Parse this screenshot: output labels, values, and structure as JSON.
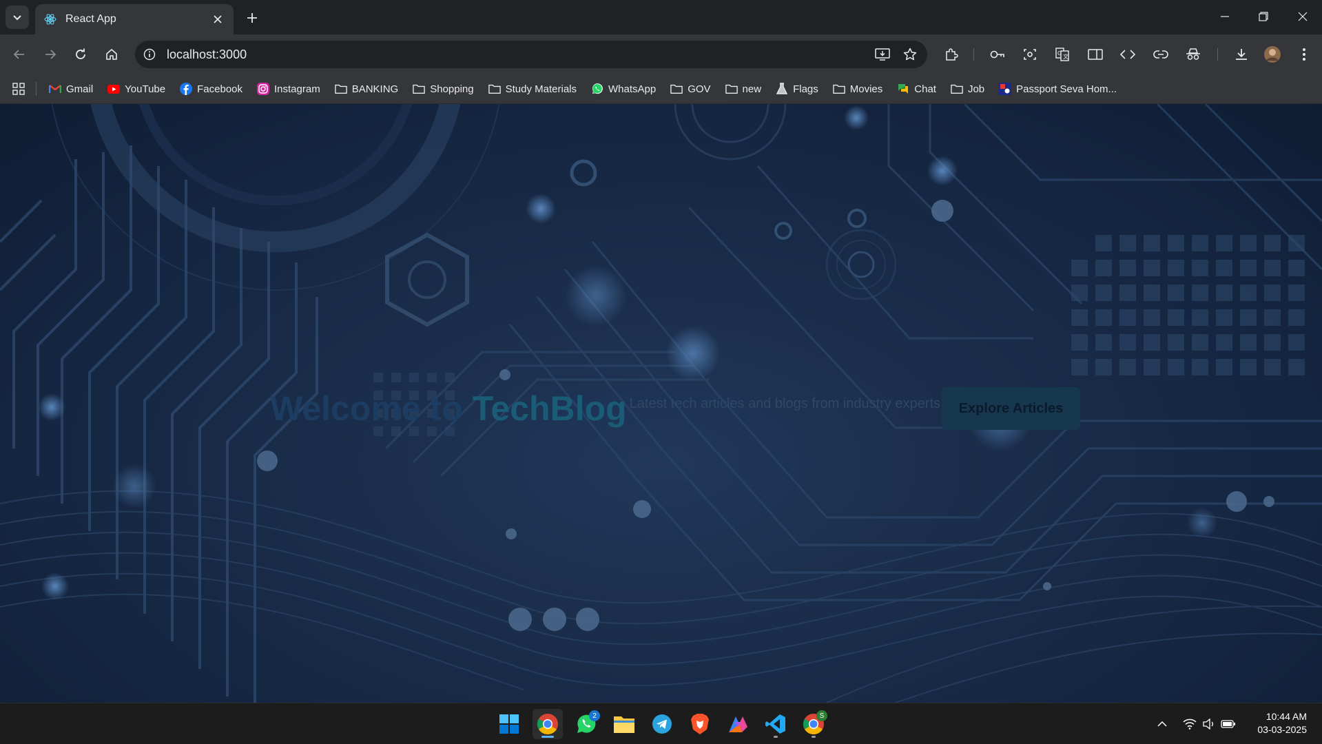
{
  "browser": {
    "tab": {
      "title": "React App"
    },
    "omnibox": {
      "url": "localhost:3000"
    },
    "bookmarks": [
      {
        "label": "Gmail",
        "icon": "gmail-icon"
      },
      {
        "label": "YouTube",
        "icon": "youtube-icon"
      },
      {
        "label": "Facebook",
        "icon": "facebook-icon"
      },
      {
        "label": "Instagram",
        "icon": "instagram-icon"
      },
      {
        "label": "BANKING",
        "icon": "folder-icon"
      },
      {
        "label": "Shopping",
        "icon": "folder-icon"
      },
      {
        "label": "Study Materials",
        "icon": "folder-icon"
      },
      {
        "label": "WhatsApp",
        "icon": "whatsapp-icon"
      },
      {
        "label": "GOV",
        "icon": "folder-icon"
      },
      {
        "label": "new",
        "icon": "folder-icon"
      },
      {
        "label": "Flags",
        "icon": "flask-icon"
      },
      {
        "label": "Movies",
        "icon": "folder-icon"
      },
      {
        "label": "Chat",
        "icon": "chat-icon"
      },
      {
        "label": "Job",
        "icon": "folder-icon"
      },
      {
        "label": "Passport Seva Hom...",
        "icon": "passport-icon"
      }
    ]
  },
  "hero": {
    "title_prefix": "Welcome to ",
    "title_accent": "TechBlog",
    "subtitle": "Latest tech articles and blogs from industry experts",
    "button_label": "Explore Articles"
  },
  "taskbar": {
    "whatsapp_badge": "2",
    "chrome2_badge": "S",
    "time": "10:44 AM",
    "date": "03-03-2025"
  },
  "colors": {
    "page_bg": "#142540",
    "title_accent": "#1a5b75",
    "button_bg": "#17374f"
  }
}
